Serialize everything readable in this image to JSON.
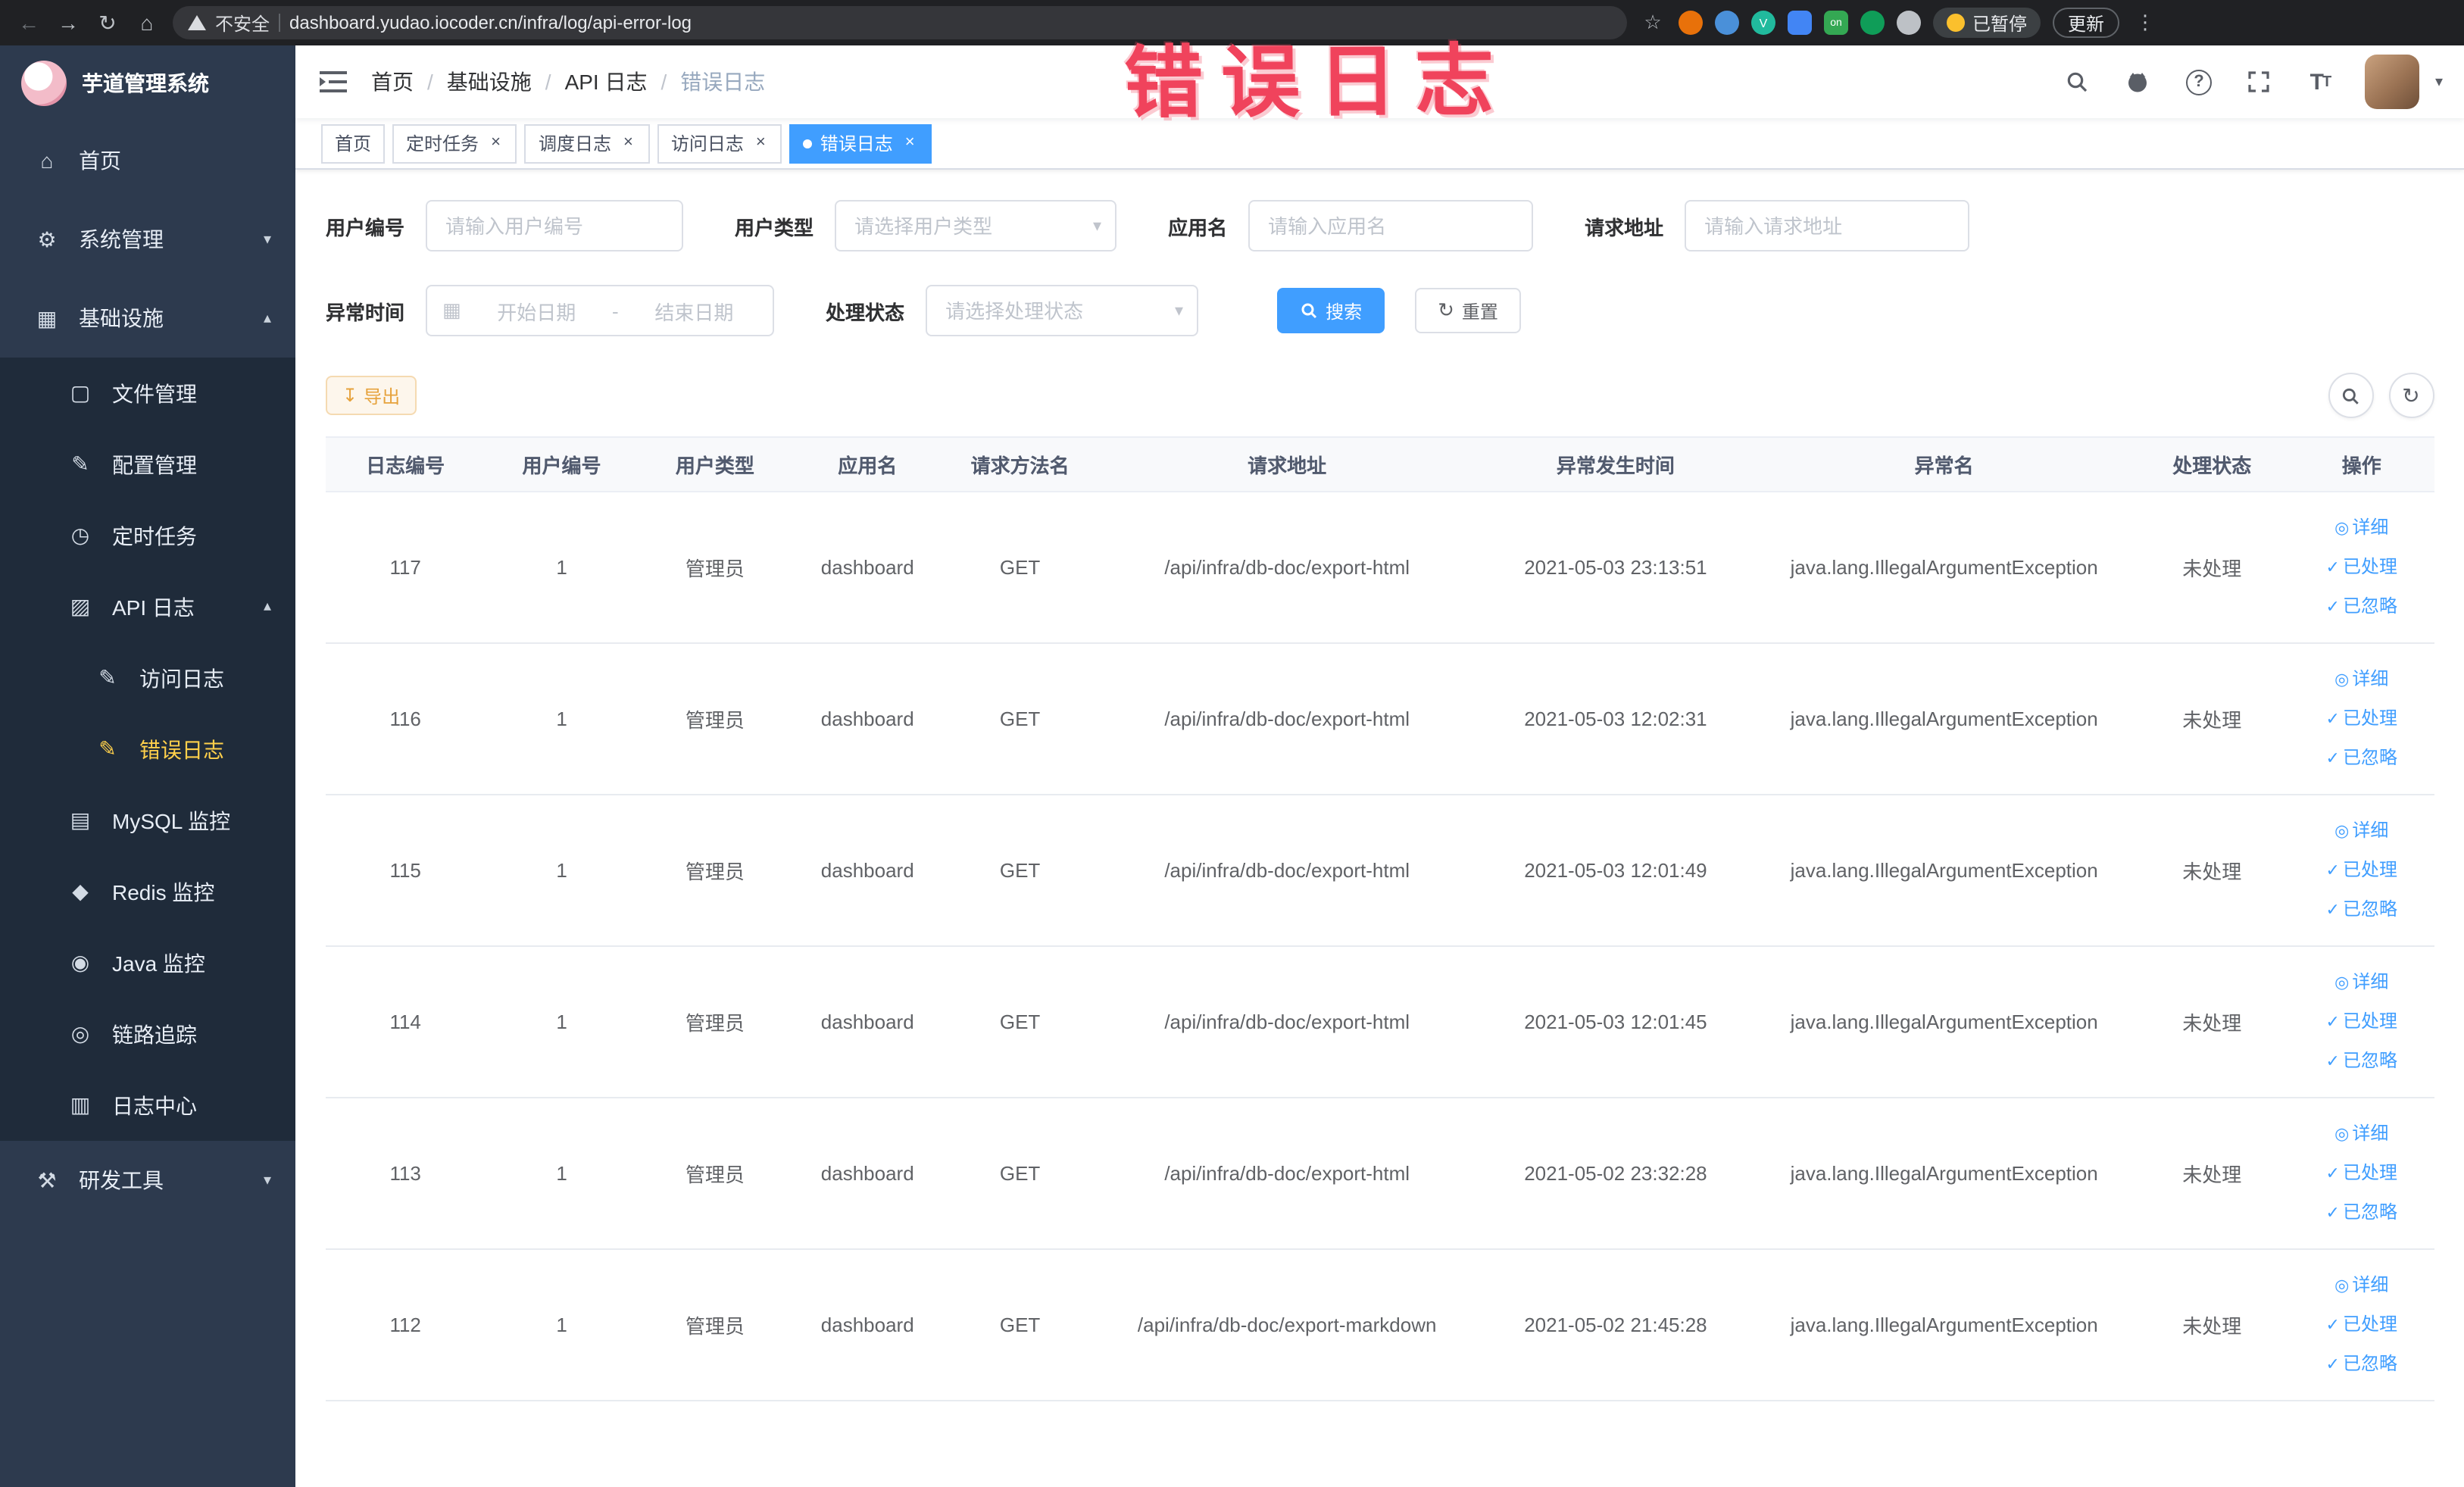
{
  "annotation": {
    "text": "错误日志",
    "color": "#f0435c"
  },
  "browser": {
    "security_label": "不安全",
    "url": "dashboard.yudao.iocoder.cn/infra/log/api-error-log",
    "paused_badge": "已暂停",
    "update_label": "更新"
  },
  "sidebar": {
    "title": "芋道管理系统",
    "menu": [
      {
        "label": "首页",
        "icon": "home-icon",
        "level": 1
      },
      {
        "label": "系统管理",
        "icon": "gear-icon",
        "level": 1,
        "arrow": "down"
      },
      {
        "label": "基础设施",
        "icon": "infra-icon",
        "level": 1,
        "arrow": "up"
      },
      {
        "label": "文件管理",
        "icon": "file-icon",
        "level": 2
      },
      {
        "label": "配置管理",
        "icon": "config-icon",
        "level": 2
      },
      {
        "label": "定时任务",
        "icon": "job-icon",
        "level": 2
      },
      {
        "label": "API 日志",
        "icon": "api-log-icon",
        "level": 2,
        "arrow": "up"
      },
      {
        "label": "访问日志",
        "icon": "access-log-icon",
        "level": 3
      },
      {
        "label": "错误日志",
        "icon": "error-log-icon",
        "level": 3,
        "active": true
      },
      {
        "label": "MySQL 监控",
        "icon": "mysql-icon",
        "level": 2
      },
      {
        "label": "Redis 监控",
        "icon": "redis-icon",
        "level": 2
      },
      {
        "label": "Java 监控",
        "icon": "java-icon",
        "level": 2
      },
      {
        "label": "链路追踪",
        "icon": "trace-icon",
        "level": 2
      },
      {
        "label": "日志中心",
        "icon": "log-center-icon",
        "level": 2
      },
      {
        "label": "研发工具",
        "icon": "tools-icon",
        "level": 1,
        "arrow": "down"
      }
    ]
  },
  "breadcrumb": [
    "首页",
    "基础设施",
    "API 日志",
    "错误日志"
  ],
  "tabs": [
    {
      "label": "首页",
      "closable": false,
      "active": false
    },
    {
      "label": "定时任务",
      "closable": true,
      "active": false
    },
    {
      "label": "调度日志",
      "closable": true,
      "active": false
    },
    {
      "label": "访问日志",
      "closable": true,
      "active": false
    },
    {
      "label": "错误日志",
      "closable": true,
      "active": true
    }
  ],
  "filters": {
    "user_id": {
      "label": "用户编号",
      "placeholder": "请输入用户编号"
    },
    "user_type": {
      "label": "用户类型",
      "placeholder": "请选择用户类型"
    },
    "app_name": {
      "label": "应用名",
      "placeholder": "请输入应用名"
    },
    "request_url": {
      "label": "请求地址",
      "placeholder": "请输入请求地址"
    },
    "exception_time": {
      "label": "异常时间",
      "start_placeholder": "开始日期",
      "separator": "-",
      "end_placeholder": "结束日期"
    },
    "process_status": {
      "label": "处理状态",
      "placeholder": "请选择处理状态"
    },
    "search_label": "搜索",
    "reset_label": "重置"
  },
  "toolbar": {
    "export_label": "导出"
  },
  "table": {
    "columns": [
      "日志编号",
      "用户编号",
      "用户类型",
      "应用名",
      "请求方法名",
      "请求地址",
      "异常发生时间",
      "异常名",
      "处理状态",
      "操作"
    ],
    "actions": [
      "详细",
      "已处理",
      "已忽略"
    ],
    "rows": [
      {
        "id": "117",
        "user_id": "1",
        "user_type": "管理员",
        "app": "dashboard",
        "method": "GET",
        "url": "/api/infra/db-doc/export-html",
        "time": "2021-05-03 23:13:51",
        "exception": "java.lang.IllegalArgumentException",
        "status": "未处理"
      },
      {
        "id": "116",
        "user_id": "1",
        "user_type": "管理员",
        "app": "dashboard",
        "method": "GET",
        "url": "/api/infra/db-doc/export-html",
        "time": "2021-05-03 12:02:31",
        "exception": "java.lang.IllegalArgumentException",
        "status": "未处理"
      },
      {
        "id": "115",
        "user_id": "1",
        "user_type": "管理员",
        "app": "dashboard",
        "method": "GET",
        "url": "/api/infra/db-doc/export-html",
        "time": "2021-05-03 12:01:49",
        "exception": "java.lang.IllegalArgumentException",
        "status": "未处理"
      },
      {
        "id": "114",
        "user_id": "1",
        "user_type": "管理员",
        "app": "dashboard",
        "method": "GET",
        "url": "/api/infra/db-doc/export-html",
        "time": "2021-05-03 12:01:45",
        "exception": "java.lang.IllegalArgumentException",
        "status": "未处理"
      },
      {
        "id": "113",
        "user_id": "1",
        "user_type": "管理员",
        "app": "dashboard",
        "method": "GET",
        "url": "/api/infra/db-doc/export-html",
        "time": "2021-05-02 23:32:28",
        "exception": "java.lang.IllegalArgumentException",
        "status": "未处理"
      },
      {
        "id": "112",
        "user_id": "1",
        "user_type": "管理员",
        "app": "dashboard",
        "method": "GET",
        "url": "/api/infra/db-doc/export-markdown",
        "time": "2021-05-02 21:45:28",
        "exception": "java.lang.IllegalArgumentException",
        "status": "未处理"
      }
    ]
  }
}
